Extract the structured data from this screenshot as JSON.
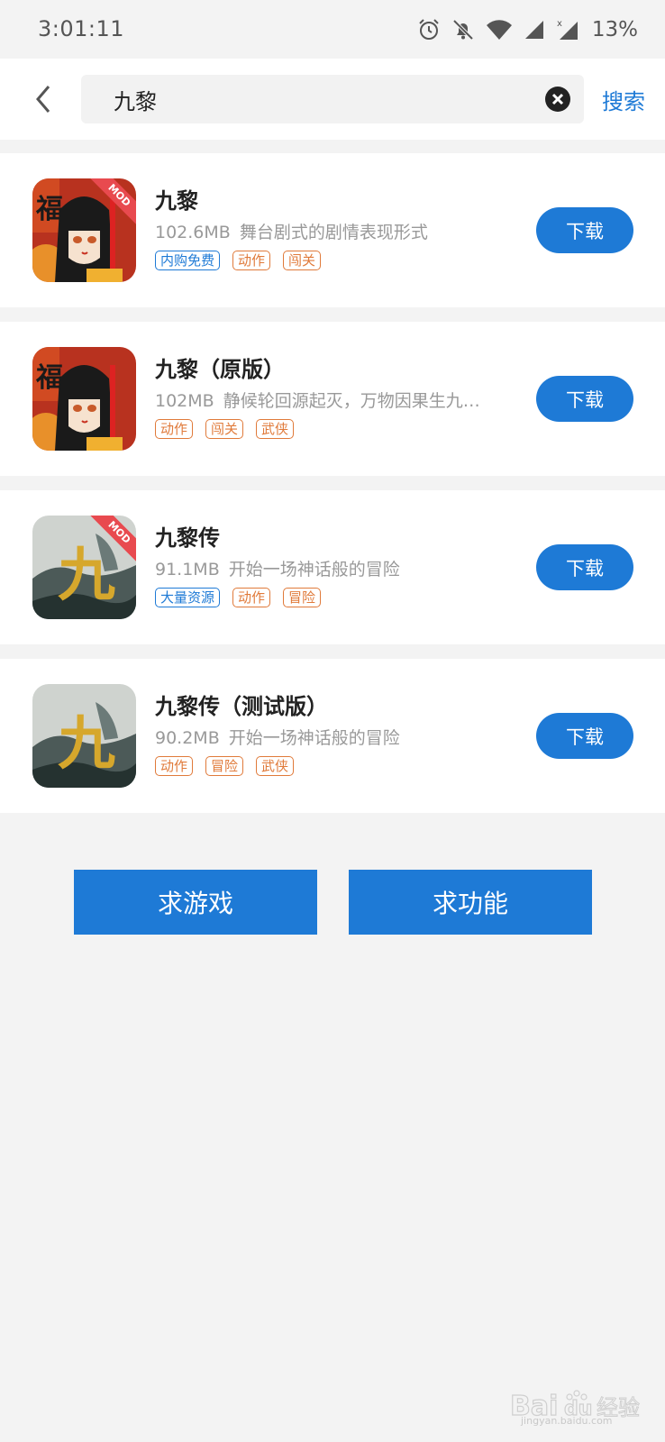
{
  "status_bar": {
    "time": "3:01:11",
    "battery": "13%",
    "icons": [
      "alarm-icon",
      "bell-off-icon",
      "wifi-icon",
      "signal-icon",
      "signal-no-data-icon"
    ]
  },
  "search": {
    "query": "九黎",
    "search_label": "搜索"
  },
  "results": [
    {
      "name": "九黎",
      "size": "102.6MB",
      "desc": "舞台剧式的剧情表现形式",
      "tags": [
        "内购免费",
        "动作",
        "闯关"
      ],
      "download_label": "下载",
      "badge": "MOD",
      "icon": "girl-fu-icon"
    },
    {
      "name": "九黎（原版）",
      "size": "102MB",
      "desc": "静候轮回源起灭，万物因果生九…",
      "tags": [
        "动作",
        "闯关",
        "武侠"
      ],
      "download_label": "下载",
      "icon": "girl-fu-icon"
    },
    {
      "name": "九黎传",
      "size": "91.1MB",
      "desc": "开始一场神话般的冒险",
      "tags": [
        "大量资源",
        "动作",
        "冒险"
      ],
      "download_label": "下载",
      "badge": "MOD",
      "icon": "jiu-ink-icon"
    },
    {
      "name": "九黎传（测试版）",
      "size": "90.2MB",
      "desc": "开始一场神话般的冒险",
      "tags": [
        "动作",
        "冒险",
        "武侠"
      ],
      "download_label": "下载",
      "icon": "jiu-ink-icon"
    }
  ],
  "actions": {
    "request_game": "求游戏",
    "request_feature": "求功能"
  },
  "watermark": {
    "logo": "Baidu经验",
    "url": "jingyan.baidu.com"
  },
  "colors": {
    "accent": "#1e7ad6",
    "tag_orange": "#e07a3a",
    "badge_red": "#e84a4f",
    "background": "#f3f3f3"
  }
}
